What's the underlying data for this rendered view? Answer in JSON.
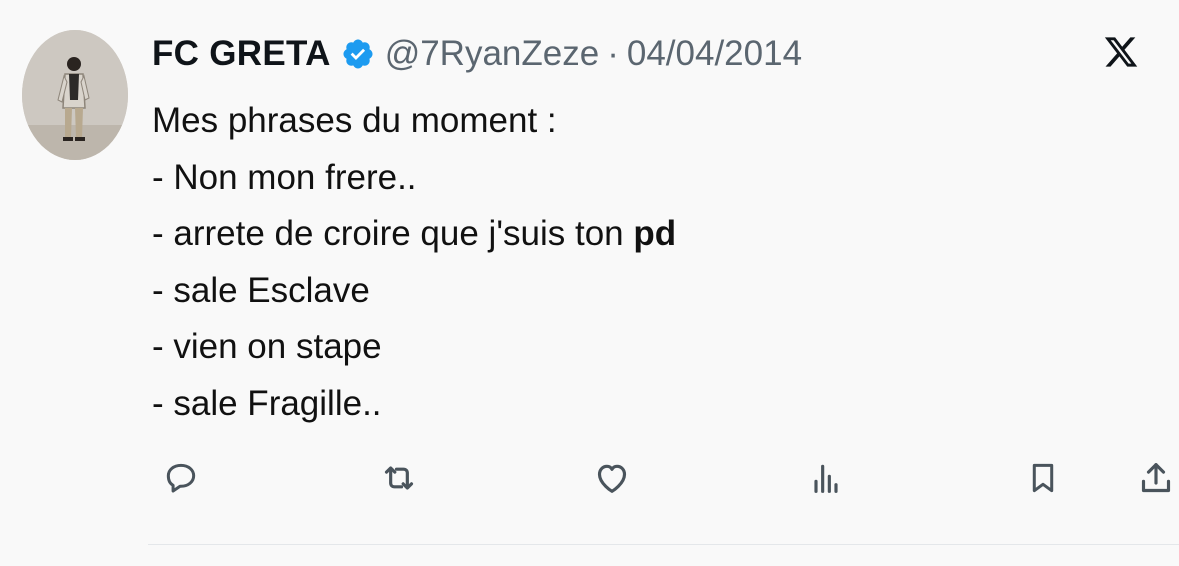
{
  "author": {
    "display_name": "FC GRETA",
    "handle": "@7RyanZeze",
    "separator": "·",
    "date": "04/04/2014",
    "verified": true
  },
  "tweet": {
    "lines": [
      "Mes phrases du moment :",
      "- Non mon frere..",
      "- arrete de croire que j'suis ton ",
      "- sale Esclave",
      "- vien on stape",
      "- sale Fragille.."
    ],
    "bold_suffix": "pd"
  },
  "icons": {
    "platform": "x-logo-icon",
    "verified": "verified-badge-icon",
    "actions": [
      "reply-icon",
      "retweet-icon",
      "like-icon",
      "views-icon",
      "bookmark-icon",
      "share-icon"
    ]
  },
  "colors": {
    "verified_badge": "#1d9bf0",
    "secondary_text": "#5b6670",
    "icon": "#4a545c"
  }
}
